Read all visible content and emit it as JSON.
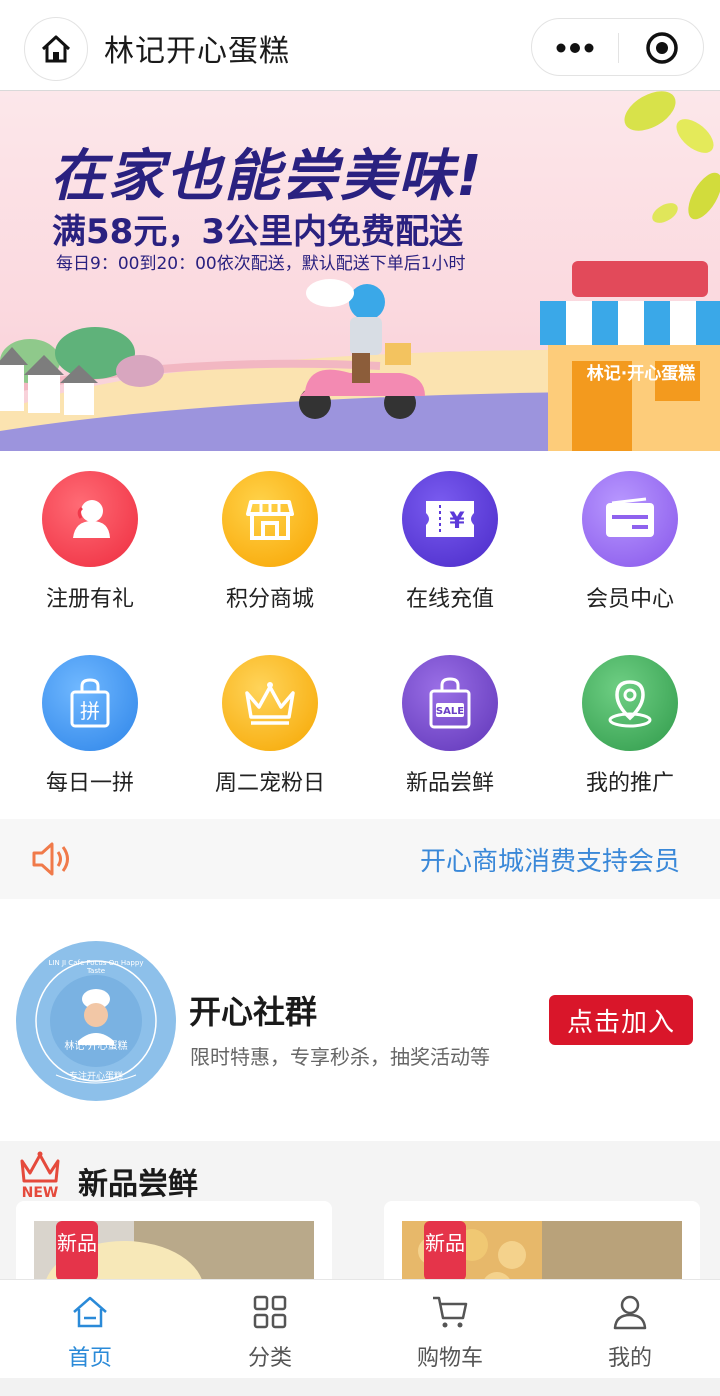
{
  "header": {
    "title": "林记开心蛋糕",
    "home_icon": "home-icon",
    "more_icon": "more-dots-icon",
    "close_icon": "target-circle-icon"
  },
  "banner": {
    "headline": "在家也能尝美味!",
    "subheadline": "满58元，3公里内免费配送",
    "detail": "每日9：00到20：00依次配送，默认配送下单后1小时",
    "shop_sign": "林记·开心蛋糕"
  },
  "grid": {
    "items": [
      {
        "label": "注册有礼",
        "icon": "user-icon",
        "color": "#f0394b"
      },
      {
        "label": "积分商城",
        "icon": "store-icon",
        "color": "#fdb40b"
      },
      {
        "label": "在线充值",
        "icon": "ticket-yen-icon",
        "color": "#5b39d9"
      },
      {
        "label": "会员中心",
        "icon": "card-icon",
        "color": "#9a6ff2"
      },
      {
        "label": "每日一拼",
        "icon": "bag-pin-icon",
        "color": "#3d95f0"
      },
      {
        "label": "周二宠粉日",
        "icon": "crown-icon",
        "color": "#fdb40b"
      },
      {
        "label": "新品尝鲜",
        "icon": "sale-bag-icon",
        "color": "#7a4fcf"
      },
      {
        "label": "我的推广",
        "icon": "location-icon",
        "color": "#3fae5c"
      }
    ]
  },
  "notice": {
    "icon": "speaker-icon",
    "text": "开心商城消费支持会员"
  },
  "community": {
    "title": "开心社群",
    "description": "限时特惠，专享秒杀，抽奖活动等",
    "join_label": "点击加入",
    "logo_text": "林记·开心蛋糕",
    "logo_ring_text": "LIN JI Cafe Focus On Happy Taste",
    "logo_bottom_text": "专注开心蛋糕"
  },
  "new_products": {
    "title": "新品尝鲜",
    "badge_text": "NEW",
    "cards": [
      {
        "tag": "新品"
      },
      {
        "tag": "新品"
      }
    ]
  },
  "tabbar": {
    "tabs": [
      {
        "label": "首页",
        "icon": "home-icon",
        "active": true
      },
      {
        "label": "分类",
        "icon": "grid-icon",
        "active": false
      },
      {
        "label": "购物车",
        "icon": "cart-icon",
        "active": false
      },
      {
        "label": "我的",
        "icon": "profile-icon",
        "active": false
      }
    ]
  },
  "colors": {
    "accent": "#2a8ad8",
    "banner_text": "#2a2180",
    "join_button": "#d9162a",
    "notice_text": "#3a88d8"
  }
}
